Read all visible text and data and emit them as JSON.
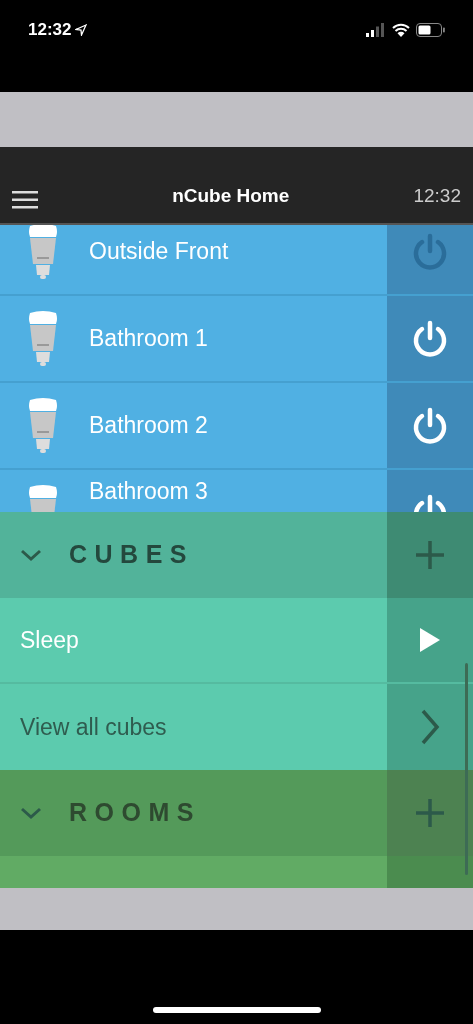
{
  "status_bar": {
    "time": "12:32"
  },
  "header": {
    "title": "nCube Home",
    "clock": "12:32"
  },
  "lights": [
    {
      "name": "Outside Front",
      "on": false
    },
    {
      "name": "Bathroom 1",
      "on": true
    },
    {
      "name": "Bathroom 2",
      "on": true
    },
    {
      "name": "Bathroom 3",
      "on": true
    }
  ],
  "sections": [
    {
      "kind": "cubes",
      "title": "CUBES",
      "expanded": true,
      "items": [
        {
          "kind": "scene",
          "label": "Sleep"
        },
        {
          "kind": "link",
          "label": "View all cubes"
        }
      ]
    },
    {
      "kind": "rooms",
      "title": "ROOMS",
      "expanded": true,
      "items": [
        {
          "kind": "room"
        }
      ]
    }
  ]
}
